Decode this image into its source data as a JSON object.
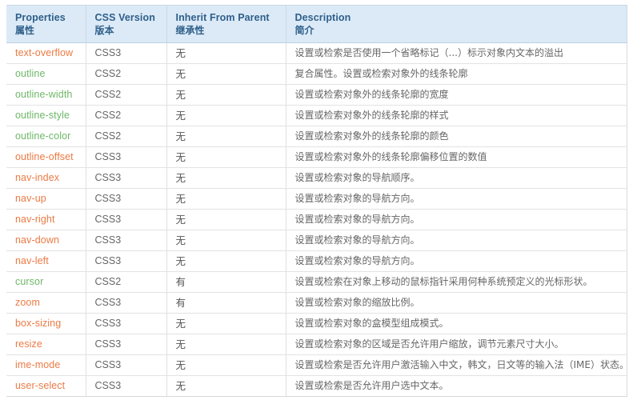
{
  "table": {
    "headers": [
      {
        "en": "Properties",
        "cn": "属性",
        "name": "properties"
      },
      {
        "en": "CSS Version",
        "cn": "版本",
        "name": "css-version"
      },
      {
        "en": "Inherit From Parent",
        "cn": "继承性",
        "name": "inherit-from-parent"
      },
      {
        "en": "Description",
        "cn": "简介",
        "name": "description"
      }
    ],
    "colors": {
      "css3_property": "#ec7a44",
      "css2_property": "#6fb868",
      "header_bg": "#dceaf7",
      "header_text": "#2e5f8a",
      "body_text": "#666666",
      "row_border": "#e3e3e3"
    },
    "rows": [
      {
        "property": "text-overflow",
        "version": "CSS3",
        "inherit": "无",
        "description": "设置或检索是否使用一个省略标记（...）标示对象内文本的溢出"
      },
      {
        "property": "outline",
        "version": "CSS2",
        "inherit": "无",
        "description": "复合属性。设置或检索对象外的线条轮廓"
      },
      {
        "property": "outline-width",
        "version": "CSS2",
        "inherit": "无",
        "description": "设置或检索对象外的线条轮廓的宽度"
      },
      {
        "property": "outline-style",
        "version": "CSS2",
        "inherit": "无",
        "description": "设置或检索对象外的线条轮廓的样式"
      },
      {
        "property": "outline-color",
        "version": "CSS2",
        "inherit": "无",
        "description": "设置或检索对象外的线条轮廓的颜色"
      },
      {
        "property": "outline-offset",
        "version": "CSS3",
        "inherit": "无",
        "description": "设置或检索对象外的线条轮廓偏移位置的数值"
      },
      {
        "property": "nav-index",
        "version": "CSS3",
        "inherit": "无",
        "description": "设置或检索对象的导航顺序。"
      },
      {
        "property": "nav-up",
        "version": "CSS3",
        "inherit": "无",
        "description": "设置或检索对象的导航方向。"
      },
      {
        "property": "nav-right",
        "version": "CSS3",
        "inherit": "无",
        "description": "设置或检索对象的导航方向。"
      },
      {
        "property": "nav-down",
        "version": "CSS3",
        "inherit": "无",
        "description": "设置或检索对象的导航方向。"
      },
      {
        "property": "nav-left",
        "version": "CSS3",
        "inherit": "无",
        "description": "设置或检索对象的导航方向。"
      },
      {
        "property": "cursor",
        "version": "CSS2",
        "inherit": "有",
        "description": "设置或检索在对象上移动的鼠标指针采用何种系统预定义的光标形状。"
      },
      {
        "property": "zoom",
        "version": "CSS3",
        "inherit": "有",
        "description": "设置或检索对象的缩放比例。"
      },
      {
        "property": "box-sizing",
        "version": "CSS3",
        "inherit": "无",
        "description": "设置或检索对象的盒模型组成模式。"
      },
      {
        "property": "resize",
        "version": "CSS3",
        "inherit": "无",
        "description": "设置或检索对象的区域是否允许用户缩放，调节元素尺寸大小。"
      },
      {
        "property": "ime-mode",
        "version": "CSS3",
        "inherit": "无",
        "description": "设置或检索是否允许用户激活输入中文，韩文，日文等的输入法（IME）状态。"
      },
      {
        "property": "user-select",
        "version": "CSS3",
        "inherit": "无",
        "description": "设置或检索是否允许用户选中文本。"
      }
    ]
  }
}
